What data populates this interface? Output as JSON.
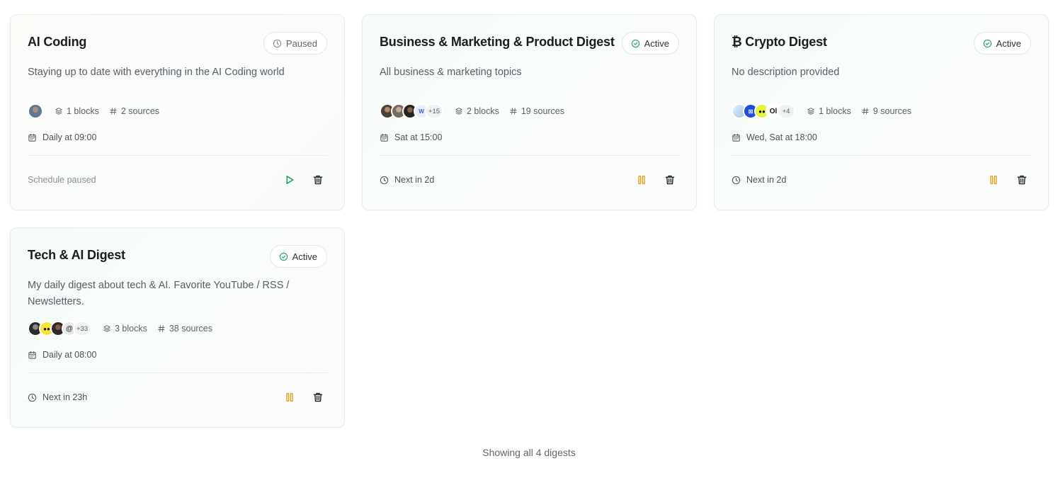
{
  "digests": [
    {
      "title": "AI Coding",
      "status": "Paused",
      "description": "Staying up to date with everything in the AI Coding world",
      "avatars": [
        {
          "color": "#6d8aa8"
        }
      ],
      "more_sources": "",
      "blocks": "1 blocks",
      "sources": "2 sources",
      "schedule": "Daily at 09:00",
      "footer": "Schedule paused",
      "primary_action": "play-icon",
      "secondary_action": "trash-icon"
    },
    {
      "title": "Business & Marketing & Product Digest",
      "status": "Active",
      "description": "All business & marketing topics",
      "avatars": [
        {
          "color": "#5b4a3f"
        },
        {
          "color": "#7b6f66"
        },
        {
          "color": "#2b2a28"
        },
        {
          "color": "#d9e6f7"
        }
      ],
      "more_sources": "+15",
      "blocks": "2 blocks",
      "sources": "19 sources",
      "schedule": "Sat at 15:00",
      "footer": "Next in 2d",
      "primary_action": "pause-icon",
      "secondary_action": "trash-icon"
    },
    {
      "title": "₿ Crypto Digest",
      "status": "Active",
      "description": "No description provided",
      "avatars": [
        {
          "color": "#cfe3f0"
        },
        {
          "color": "#1f4fd8"
        },
        {
          "color": "#e6f53a"
        },
        {
          "color": "#111111"
        }
      ],
      "more_sources": "+4",
      "blocks": "1 blocks",
      "sources": "9 sources",
      "schedule": "Wed, Sat at 18:00",
      "footer": "Next in 2d",
      "primary_action": "pause-icon",
      "secondary_action": "trash-icon"
    },
    {
      "title": "Tech & AI Digest",
      "status": "Active",
      "description": "My daily digest about tech & AI. Favorite YouTube / RSS / Newsletters.",
      "avatars": [
        {
          "color": "#2f2f2f"
        },
        {
          "color": "#f5e536"
        },
        {
          "color": "#3b3536"
        },
        {
          "color": "#e7e7e7"
        }
      ],
      "more_sources": "+33",
      "blocks": "3 blocks",
      "sources": "38 sources",
      "schedule": "Daily at 08:00",
      "footer": "Next in 23h",
      "primary_action": "pause-icon",
      "secondary_action": "trash-icon"
    }
  ],
  "summary": "Showing all 4 digests",
  "colors": {
    "active": "#22a06b",
    "pause": "#e0a21a",
    "play": "#1f9d55"
  }
}
